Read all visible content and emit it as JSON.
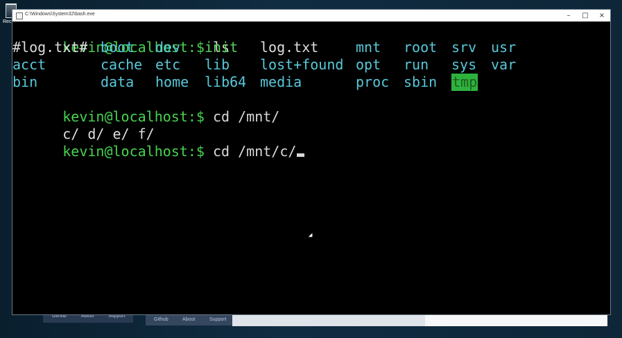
{
  "window": {
    "title": "C:\\Windows\\System32\\bash.exe",
    "controls": {
      "minimize": "–",
      "maximize": "□",
      "close": "×"
    }
  },
  "desktop": {
    "recycle_bin_label": "Recyc"
  },
  "background_links": {
    "left": [
      "Github",
      "About",
      "Support"
    ],
    "right": [
      "Github",
      "About",
      "Support"
    ]
  },
  "terminal": {
    "prompt": "kevin@localhost:$",
    "commands": {
      "ls": "ls",
      "cd_mnt": "cd /mnt/",
      "cd_mnt_c": "cd /mnt/c/"
    },
    "ls_output": {
      "row1": [
        "#log.txt#",
        "boot",
        "dev",
        "init",
        "log.txt",
        "mnt",
        "root",
        "srv",
        "usr"
      ],
      "row2": [
        "acct",
        "cache",
        "etc",
        "lib",
        "lost+found",
        "opt",
        "run",
        "sys",
        "var"
      ],
      "row3": [
        "bin",
        "data",
        "home",
        "lib64",
        "media",
        "proc",
        "sbin",
        "tmp"
      ]
    },
    "mnt_output": "c/ d/ e/ f/"
  },
  "colors": {
    "prompt_green": "#46d34f",
    "directory_cyan": "#58c8d9",
    "green_file": "#56d35c",
    "highlight_green": "#2db33d"
  }
}
